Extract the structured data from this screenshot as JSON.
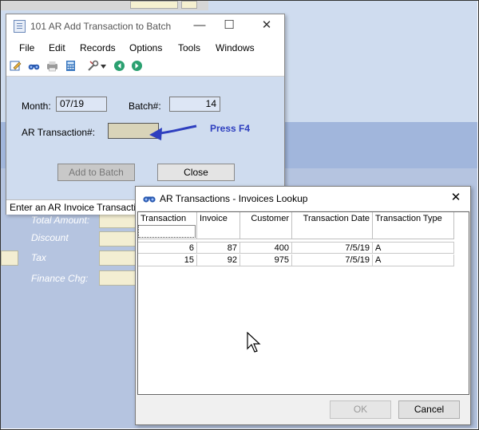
{
  "add_window": {
    "title": "101 AR Add Transaction to Batch",
    "menu": [
      "File",
      "Edit",
      "Records",
      "Options",
      "Tools",
      "Windows"
    ],
    "toolbar_icons": [
      "edit-icon",
      "binoculars-icon",
      "print-icon",
      "calculator-icon",
      "tools-icon",
      "back-icon",
      "forward-icon"
    ],
    "month_label": "Month:",
    "month_value": "07/19",
    "batch_label": "Batch#:",
    "batch_value": "14",
    "ar_label": "AR Transaction#:",
    "ar_value": "",
    "add_button": "Add to Batch",
    "close_button": "Close",
    "status_text": "Enter an AR Invoice Transaction"
  },
  "annotation": {
    "hint": "Press F4",
    "arrow_color": "#2e3fbf"
  },
  "background_form": {
    "labels": [
      "Total Amount:",
      "Discount",
      "Tax",
      "Finance Chg:"
    ]
  },
  "lookup": {
    "title": "AR Transactions - Invoices Lookup",
    "columns": [
      "Transaction",
      "Invoice",
      "Customer",
      "Transaction Date",
      "Transaction Type"
    ],
    "rows": [
      [
        "6",
        "87",
        "400",
        "7/5/19",
        "A"
      ],
      [
        "15",
        "92",
        "975",
        "7/5/19",
        "A"
      ]
    ],
    "ok_button": "OK",
    "cancel_button": "Cancel"
  },
  "colors": {
    "window_bg": "#cfdcef",
    "band": "#a1b6dc",
    "field_tan": "#d9d4b9"
  }
}
